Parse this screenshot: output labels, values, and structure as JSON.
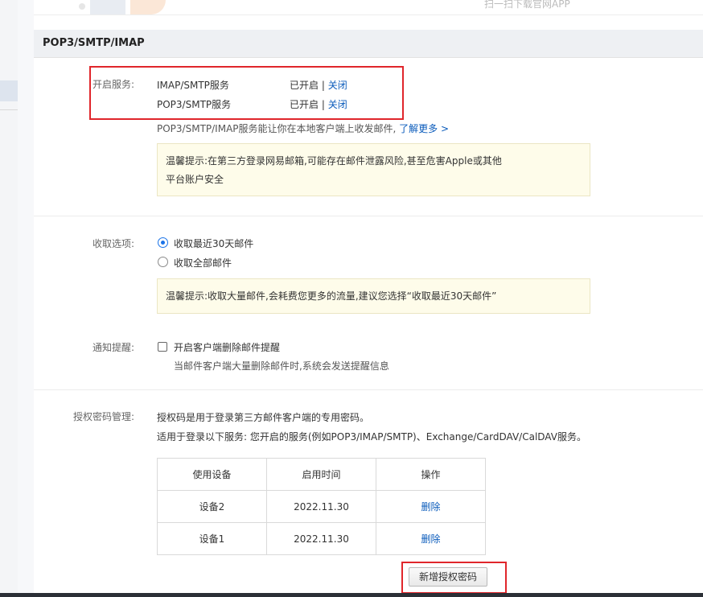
{
  "top": {
    "qr_text": "扫一扫下载官网APP"
  },
  "section": {
    "title": "POP3/SMTP/IMAP"
  },
  "services": {
    "label": "开启服务:",
    "items": [
      {
        "name": "IMAP/SMTP服务",
        "status": "已开启",
        "sep": "|",
        "action": "关闭"
      },
      {
        "name": "POP3/SMTP服务",
        "status": "已开启",
        "sep": "|",
        "action": "关闭"
      }
    ],
    "desc": "POP3/SMTP/IMAP服务能让你在本地客户端上收发邮件,",
    "learn_more": "了解更多 >",
    "notice_line1": "温馨提示:在第三方登录网易邮箱,可能存在邮件泄露风险,甚至危害Apple或其他",
    "notice_line2": "平台账户安全"
  },
  "receive": {
    "label": "收取选项:",
    "options": [
      {
        "label": "收取最近30天邮件",
        "checked": true
      },
      {
        "label": "收取全部邮件",
        "checked": false
      }
    ],
    "notice": "温馨提示:收取大量邮件,会耗费您更多的流量,建议您选择“收取最近30天邮件”"
  },
  "notify": {
    "label": "通知提醒:",
    "checkbox_label": "开启客户端删除邮件提醒",
    "checked": false,
    "hint": "当邮件客户端大量删除邮件时,系统会发送提醒信息"
  },
  "auth": {
    "label": "授权密码管理:",
    "line1": "授权码是用于登录第三方邮件客户端的专用密码。",
    "line2": "适用于登录以下服务: 您开启的服务(例如POP3/IMAP/SMTP)、Exchange/CardDAV/CalDAV服务。",
    "columns": [
      "使用设备",
      "启用时间",
      "操作"
    ],
    "rows": [
      {
        "device": "设备2",
        "date": "2022.11.30",
        "action": "删除"
      },
      {
        "device": "设备1",
        "date": "2022.11.30",
        "action": "删除"
      }
    ],
    "new_button": "新增授权密码"
  },
  "colors": {
    "link": "#0a5bbb",
    "highlight": "#e0262b",
    "notice_bg": "#fefcea"
  }
}
